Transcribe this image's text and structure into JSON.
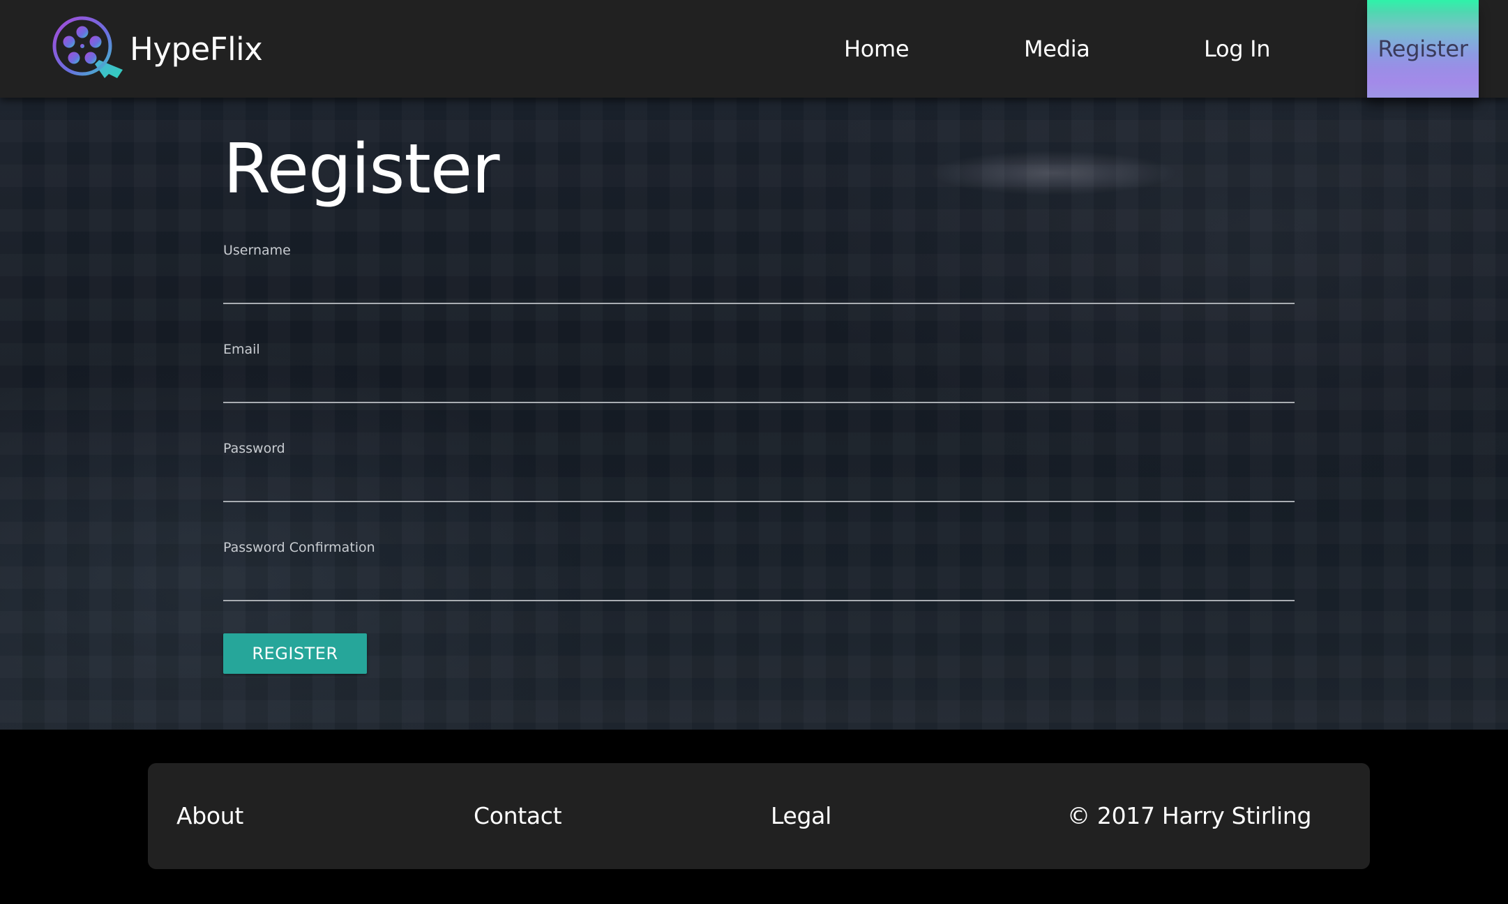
{
  "header": {
    "brand_name": "HypeFlix",
    "logo_icon": "film-reel-icon",
    "nav": [
      {
        "label": "Home"
      },
      {
        "label": "Media"
      },
      {
        "label": "Log In"
      },
      {
        "label": "Register",
        "active": true
      }
    ]
  },
  "form": {
    "title": "Register",
    "fields": [
      {
        "label": "Username",
        "value": ""
      },
      {
        "label": "Email",
        "value": ""
      },
      {
        "label": "Password",
        "value": ""
      },
      {
        "label": "Password Confirmation",
        "value": ""
      }
    ],
    "submit_label": "REGISTER"
  },
  "footer": {
    "links": [
      {
        "label": "About"
      },
      {
        "label": "Contact"
      },
      {
        "label": "Legal"
      }
    ],
    "copyright": "© 2017 Harry Stirling"
  },
  "colors": {
    "header_bg": "#212121",
    "accent": "#26a69a",
    "footer_bg": "#000000",
    "footer_card_bg": "#212121"
  }
}
